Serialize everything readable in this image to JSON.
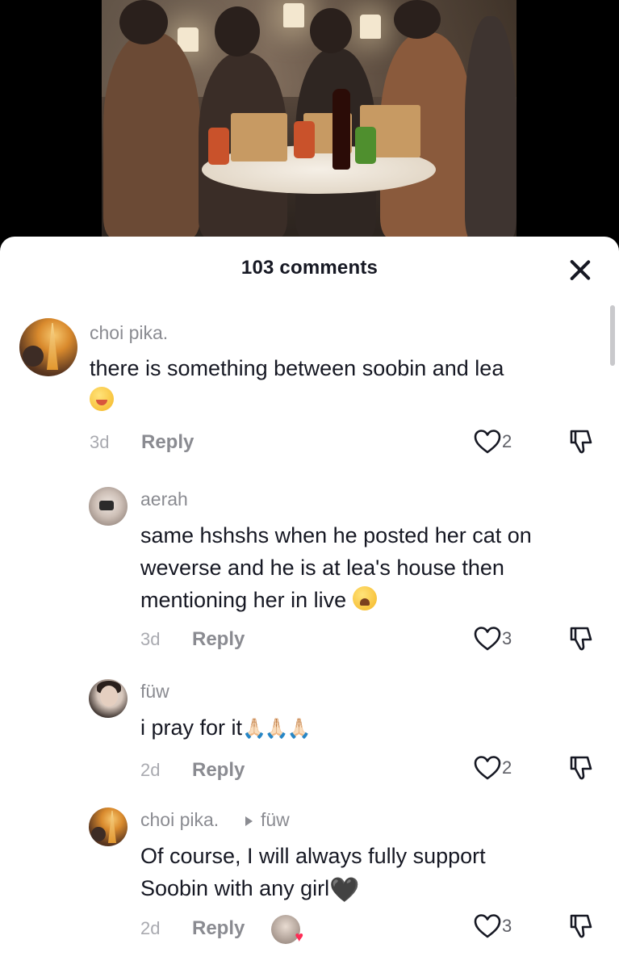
{
  "sheet": {
    "title": "103 comments"
  },
  "comments": [
    {
      "username": "choi pika.",
      "text": "there is something between soobin and lea",
      "emoji": "yum",
      "time": "3d",
      "reply_label": "Reply",
      "likes": "2"
    },
    {
      "username": "aerah",
      "text_lines": [
        "same hshshs when he posted her cat on",
        "weverse and he is at lea's house then",
        "mentioning her in live"
      ],
      "emoji": "weary",
      "time": "3d",
      "reply_label": "Reply",
      "likes": "3"
    },
    {
      "username": "füw",
      "text": "i pray for it",
      "emoji": "folded-hands",
      "emoji_glyphs": "🙏🏻🙏🏻🙏🏻",
      "time": "2d",
      "reply_label": "Reply",
      "likes": "2"
    },
    {
      "username": "choi pika.",
      "reply_to": "füw",
      "text_lines": [
        "Of course, I will always fully support",
        "Soobin with any girl"
      ],
      "emoji": "black-heart",
      "emoji_glyph": "🖤",
      "time": "2d",
      "reply_label": "Reply",
      "likes": "3",
      "creator_liked": true
    }
  ],
  "icons": [
    "close-icon",
    "heart-outline-icon",
    "dislike-icon"
  ],
  "colors": {
    "sheet_bg": "#ffffff",
    "primary_text": "#161823",
    "secondary_text": "#8a8b91",
    "liked_accent": "#fe2c55"
  }
}
